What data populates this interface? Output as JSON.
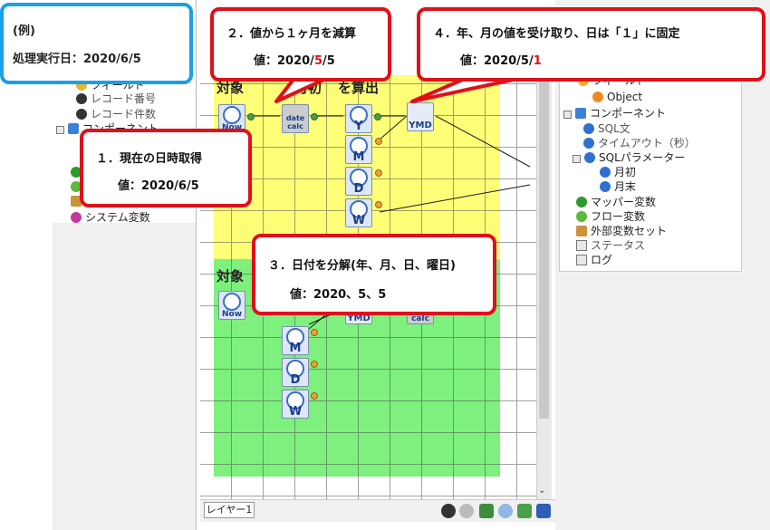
{
  "example": {
    "title": "(例)",
    "line": "処理実行日：2020/6/5"
  },
  "left_tree": {
    "items": [
      {
        "label": "フィールド"
      },
      {
        "label": "レコード番号"
      },
      {
        "label": "レコード件数"
      },
      {
        "label": "コンポーネント"
      },
      {
        "label": "システム変数"
      }
    ]
  },
  "right_tree": {
    "items": [
      {
        "label": "フィールド"
      },
      {
        "label": "Object"
      },
      {
        "label": "コンポーネント"
      },
      {
        "label": "SQL文"
      },
      {
        "label": "タイムアウト（秒）"
      },
      {
        "label": "SQLパラメーター"
      },
      {
        "label": "月初"
      },
      {
        "label": "月末"
      },
      {
        "label": "マッパー変数"
      },
      {
        "label": "フロー変数"
      },
      {
        "label": "外部変数セット"
      },
      {
        "label": "ステータス"
      },
      {
        "label": "ログ"
      }
    ]
  },
  "canvas": {
    "zone1_label": "対象",
    "zone1_label_b": "月初",
    "zone1_label_c": "を算出",
    "zone2_label": "対象",
    "nodes": {
      "now": "Now",
      "datecalc": "date\ncalc",
      "ymd": "YMD",
      "y": "Y",
      "m": "M",
      "d": "D",
      "w": "W",
      "calc": "calc"
    }
  },
  "bottom_bar": {
    "layer_tab": "レイヤー1"
  },
  "callouts": {
    "c1": {
      "title": "１．現在の日時取得",
      "value": "値：2020/6/5"
    },
    "c2": {
      "title": "２．値から１ヶ月を減算",
      "value_pre": "値：2020/",
      "value_red": "5",
      "value_post": "/5"
    },
    "c3": {
      "title": "３．日付を分解(年、月、日、曜日)",
      "value": "値：2020、5、5"
    },
    "c4": {
      "title": "４．年、月の値を受け取り、日は「１」に固定",
      "value_pre": "値：2020/5/",
      "value_red": "1"
    }
  }
}
